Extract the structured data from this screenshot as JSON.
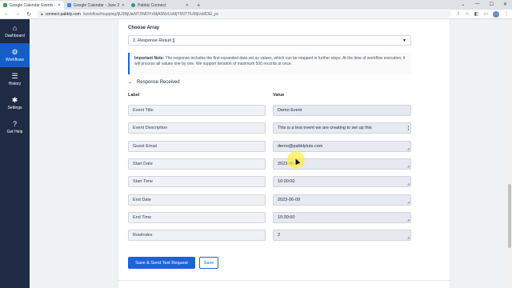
{
  "browser": {
    "tabs": [
      {
        "title": "Google Calendar Events - Googl",
        "favicon_color": "#34a853",
        "active": true
      },
      {
        "title": "Google Calendar - June 2023",
        "favicon_color": "#4285f4",
        "active": false
      },
      {
        "title": "Pabbly Connect",
        "favicon_color": "#22a06b",
        "active": false
      }
    ],
    "new_tab": "+",
    "url_host": "connect.pabbly.com",
    "url_path": "/workflow/mapping/IjU3NjUwNTZiMDYzMjA0MzUxMjY5NTTiUMjUxMDEi_pc"
  },
  "sidebar": {
    "items": [
      {
        "label": "Dashboard",
        "icon": "home-icon",
        "glyph": "⌂"
      },
      {
        "label": "Workflows",
        "icon": "workflow-icon",
        "glyph": "⚙"
      },
      {
        "label": "History",
        "icon": "history-icon",
        "glyph": "☰"
      },
      {
        "label": "Settings",
        "icon": "gear-icon",
        "glyph": "✱"
      },
      {
        "label": "Get Help",
        "icon": "help-icon",
        "glyph": "?"
      }
    ]
  },
  "form": {
    "choose_array_label": "Choose Array",
    "choose_array_value": "2. Response Result []",
    "note_title": "Important Note:",
    "note_text": "The response includes the first expanded data set as values, which can be mapped in further steps. At the time of workflow execution, it will process all values one by one. We support iteration of maximum 500 records at once.",
    "response_received": "Response Received",
    "label_header": "Label",
    "value_header": "Value",
    "rows": [
      {
        "label": "Event Title",
        "value": "Demo Event"
      },
      {
        "label": "Event Description",
        "value": "This is a test event we are creating to set up this"
      },
      {
        "label": "Guest Email",
        "value": "demo@pabblytuts.com"
      },
      {
        "label": "Start Date",
        "value": "2023-06-09"
      },
      {
        "label": "Start Time",
        "value": "10:00:00"
      },
      {
        "label": "End Date",
        "value": "2023-06-09"
      },
      {
        "label": "End Time",
        "value": "10:30:00"
      },
      {
        "label": "RowIndex",
        "value": "2"
      }
    ],
    "save_send_label": "Save & Send Test Request",
    "save_label": "Save"
  },
  "colors": {
    "sidebar_bg": "#1f2a44",
    "sidebar_active": "#155ec9",
    "primary": "#1e63d6"
  }
}
